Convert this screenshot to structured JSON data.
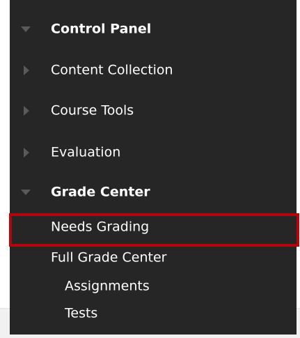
{
  "menu": {
    "control_panel": "Control Panel",
    "content_collection": "Content Collection",
    "course_tools": "Course Tools",
    "evaluation": "Evaluation",
    "grade_center": "Grade Center",
    "needs_grading": "Needs Grading",
    "full_grade_center": "Full Grade Center",
    "assignments": "Assignments",
    "tests": "Tests"
  },
  "colors": {
    "panel_background": "#262626",
    "text": "#ffffff",
    "arrow": "#5a5a5a",
    "highlight_border": "#b3060c"
  },
  "icons": {
    "expanded": "caret-down-icon",
    "collapsed": "caret-right-icon"
  }
}
